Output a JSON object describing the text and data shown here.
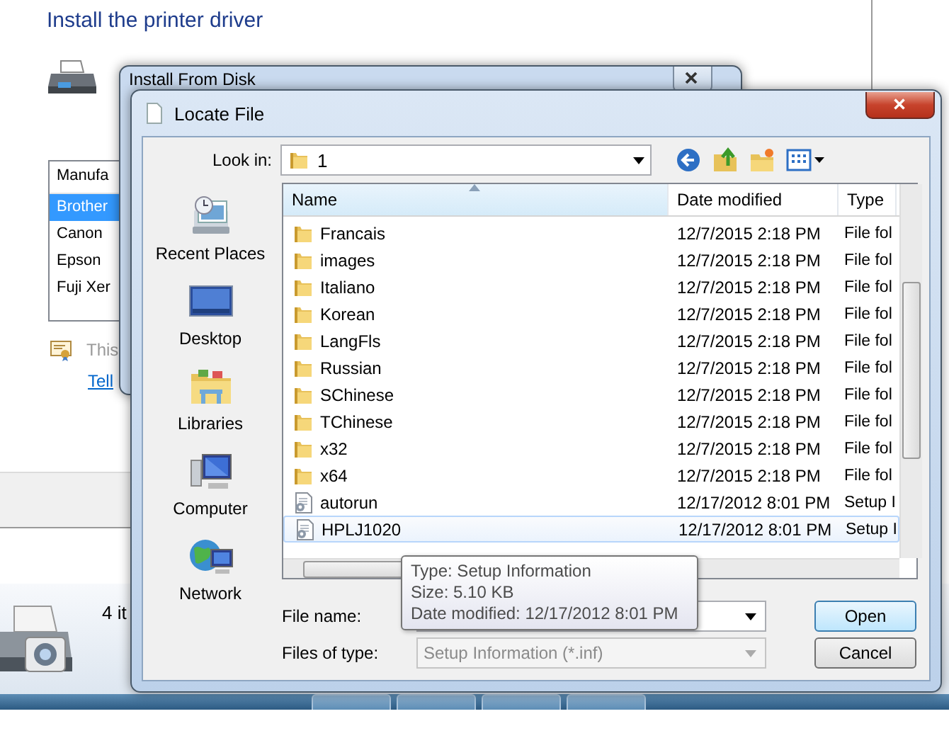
{
  "background_window": {
    "heading": "Install the printer driver",
    "manufacturer_list": {
      "header": "Manufa",
      "items": [
        {
          "label": "Brother",
          "selected": true
        },
        {
          "label": "Canon",
          "selected": false
        },
        {
          "label": "Epson",
          "selected": false
        },
        {
          "label": "Fuji Xer",
          "selected": false
        }
      ]
    },
    "note": "This",
    "link": "Tell"
  },
  "install_from_disk": {
    "title": "Install From Disk"
  },
  "locate_file": {
    "title": "Locate File",
    "look_in": {
      "label": "Look in:",
      "value": "1"
    },
    "places": [
      {
        "label": "Recent Places",
        "kind": "recent"
      },
      {
        "label": "Desktop",
        "kind": "desktop"
      },
      {
        "label": "Libraries",
        "kind": "libraries"
      },
      {
        "label": "Computer",
        "kind": "computer"
      },
      {
        "label": "Network",
        "kind": "network"
      }
    ],
    "columns": [
      "Name",
      "Date modified",
      "Type"
    ],
    "rows": [
      {
        "name": "Francais",
        "date": "12/7/2015 2:18 PM",
        "type": "File fol",
        "kind": "folder",
        "hovered": false
      },
      {
        "name": "images",
        "date": "12/7/2015 2:18 PM",
        "type": "File fol",
        "kind": "folder",
        "hovered": false
      },
      {
        "name": "Italiano",
        "date": "12/7/2015 2:18 PM",
        "type": "File fol",
        "kind": "folder",
        "hovered": false
      },
      {
        "name": "Korean",
        "date": "12/7/2015 2:18 PM",
        "type": "File fol",
        "kind": "folder",
        "hovered": false
      },
      {
        "name": "LangFls",
        "date": "12/7/2015 2:18 PM",
        "type": "File fol",
        "kind": "folder",
        "hovered": false
      },
      {
        "name": "Russian",
        "date": "12/7/2015 2:18 PM",
        "type": "File fol",
        "kind": "folder",
        "hovered": false
      },
      {
        "name": "SChinese",
        "date": "12/7/2015 2:18 PM",
        "type": "File fol",
        "kind": "folder",
        "hovered": false
      },
      {
        "name": "TChinese",
        "date": "12/7/2015 2:18 PM",
        "type": "File fol",
        "kind": "folder",
        "hovered": false
      },
      {
        "name": "x32",
        "date": "12/7/2015 2:18 PM",
        "type": "File fol",
        "kind": "folder",
        "hovered": false
      },
      {
        "name": "x64",
        "date": "12/7/2015 2:18 PM",
        "type": "File fol",
        "kind": "folder",
        "hovered": false
      },
      {
        "name": "autorun",
        "date": "12/17/2012 8:01 PM",
        "type": "Setup I",
        "kind": "setup",
        "hovered": false
      },
      {
        "name": "HPLJ1020",
        "date": "12/17/2012 8:01 PM",
        "type": "Setup I",
        "kind": "setup",
        "hovered": true
      }
    ],
    "tooltip": {
      "lines": [
        "Type: Setup Information",
        "Size: 5.10 KB",
        "Date modified: 12/17/2012 8:01 PM"
      ]
    },
    "file_name": {
      "label": "File name:"
    },
    "files_of_type": {
      "label": "Files of type:",
      "value": "Setup Information (*.inf)",
      "disabled": true
    },
    "buttons": [
      {
        "label": "Open",
        "default": true
      },
      {
        "label": "Cancel",
        "default": false
      }
    ]
  },
  "status": {
    "text": "4 it"
  }
}
